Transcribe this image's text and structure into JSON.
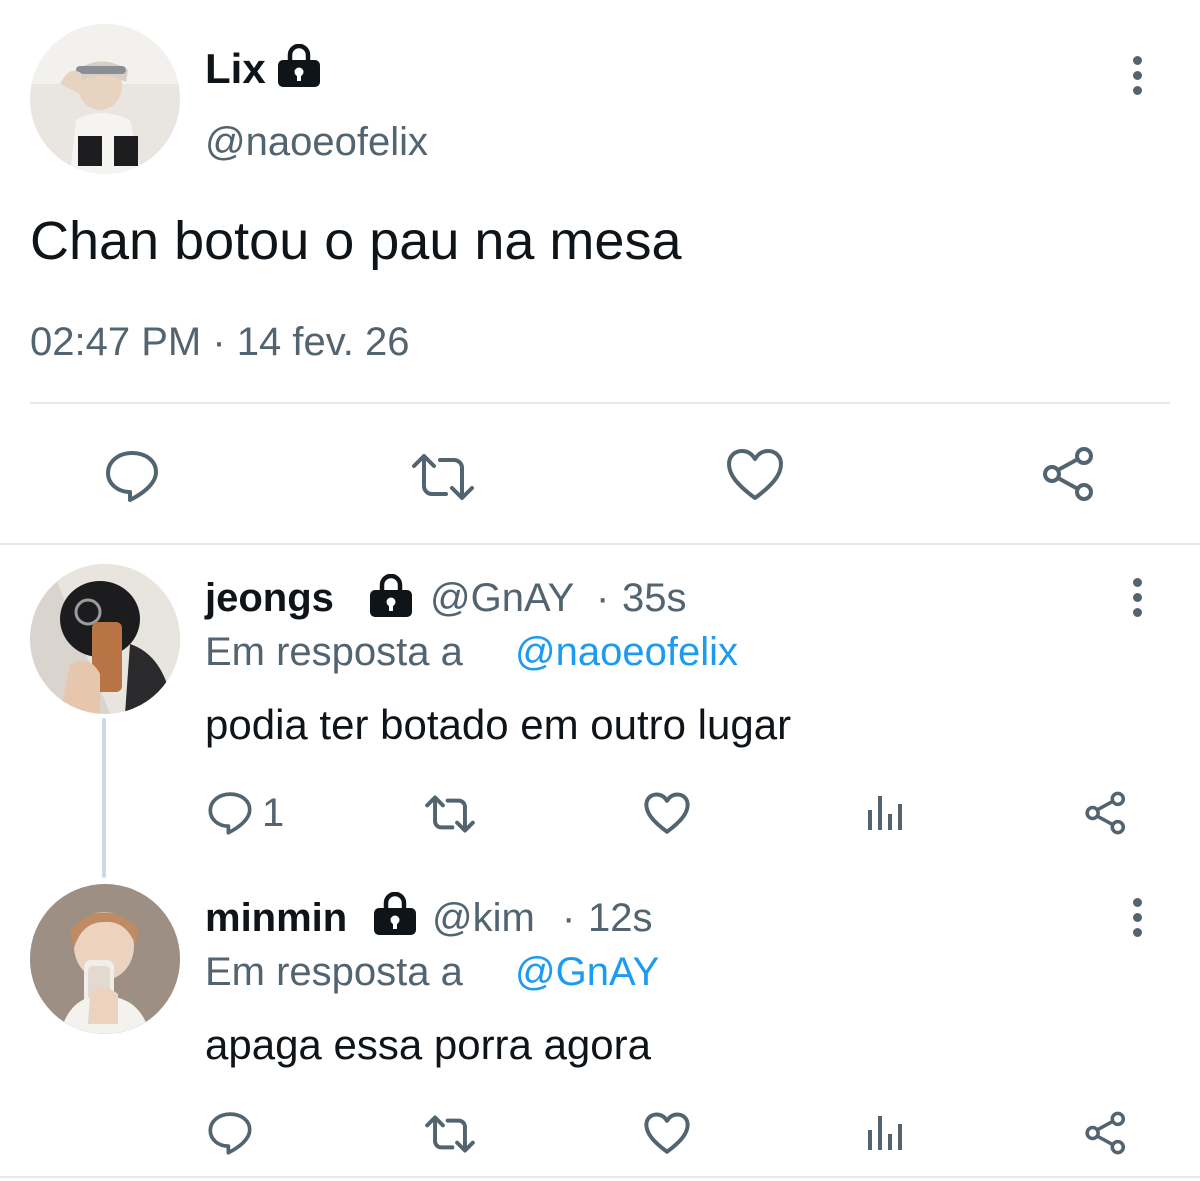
{
  "main_tweet": {
    "display_name": "Lix",
    "handle": "@naoeofelix",
    "text": "Chan botou o pau na mesa",
    "timestamp": "02:47 PM · 14 fev. 26",
    "avatar": "avatar-lix",
    "protected_icon": "lock-icon",
    "actions": [
      "reply-icon",
      "retweet-icon",
      "like-icon",
      "share-icon"
    ]
  },
  "replies": [
    {
      "display_name": "jeongs",
      "handle": "@GnAY",
      "separator": "·",
      "time": "35s",
      "reply_prefix": "Em resposta a",
      "reply_to": "@naoeofelix",
      "text": "podia ter botado em outro lugar",
      "reply_count": "1",
      "avatar": "avatar-jeongs"
    },
    {
      "display_name": "minmin",
      "handle": "@kim",
      "separator": "·",
      "time": "12s",
      "reply_prefix": "Em resposta a",
      "reply_to": "@GnAY",
      "text": "apaga essa porra agora",
      "reply_count": "",
      "avatar": "avatar-minmin"
    }
  ],
  "colors": {
    "text": "#0f1419",
    "secondary": "#536471",
    "link": "#1d9bf0",
    "divider": "#e6e9ec"
  }
}
